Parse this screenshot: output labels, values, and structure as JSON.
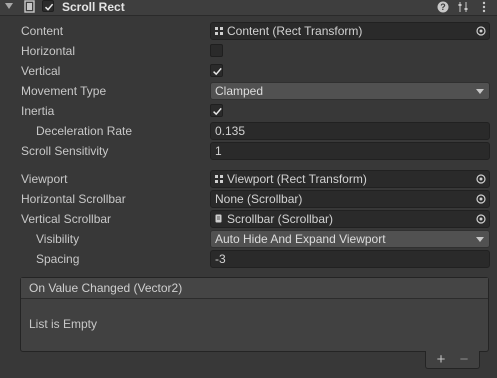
{
  "header": {
    "title": "Scroll Rect",
    "enabled": true,
    "icons": [
      "fold-arrow-icon",
      "component-icon",
      "help-icon",
      "preset-icon",
      "kebab-menu-icon"
    ]
  },
  "properties": {
    "content": {
      "label": "Content",
      "value": "Content (Rect Transform)",
      "icon": "rect-transform-icon"
    },
    "horizontal": {
      "label": "Horizontal",
      "checked": false
    },
    "vertical": {
      "label": "Vertical",
      "checked": true
    },
    "movement_type": {
      "label": "Movement Type",
      "value": "Clamped"
    },
    "inertia": {
      "label": "Inertia",
      "checked": true
    },
    "deceleration_rate": {
      "label": "Deceleration Rate",
      "value": "0.135"
    },
    "scroll_sensitivity": {
      "label": "Scroll Sensitivity",
      "value": "1"
    },
    "viewport": {
      "label": "Viewport",
      "value": "Viewport (Rect Transform)",
      "icon": "rect-transform-icon"
    },
    "horizontal_scrollbar": {
      "label": "Horizontal Scrollbar",
      "value": "None (Scrollbar)"
    },
    "vertical_scrollbar": {
      "label": "Vertical Scrollbar",
      "value": "Scrollbar (Scrollbar)",
      "icon": "script-icon"
    },
    "visibility": {
      "label": "Visibility",
      "value": "Auto Hide And Expand Viewport"
    },
    "spacing": {
      "label": "Spacing",
      "value": "-3"
    }
  },
  "event": {
    "title": "On Value Changed (Vector2)",
    "empty_text": "List is Empty",
    "add_label": "+",
    "remove_label": "−"
  },
  "colors": {
    "background": "#383838",
    "field": "#2a2a2a",
    "dropdown": "#515151"
  }
}
